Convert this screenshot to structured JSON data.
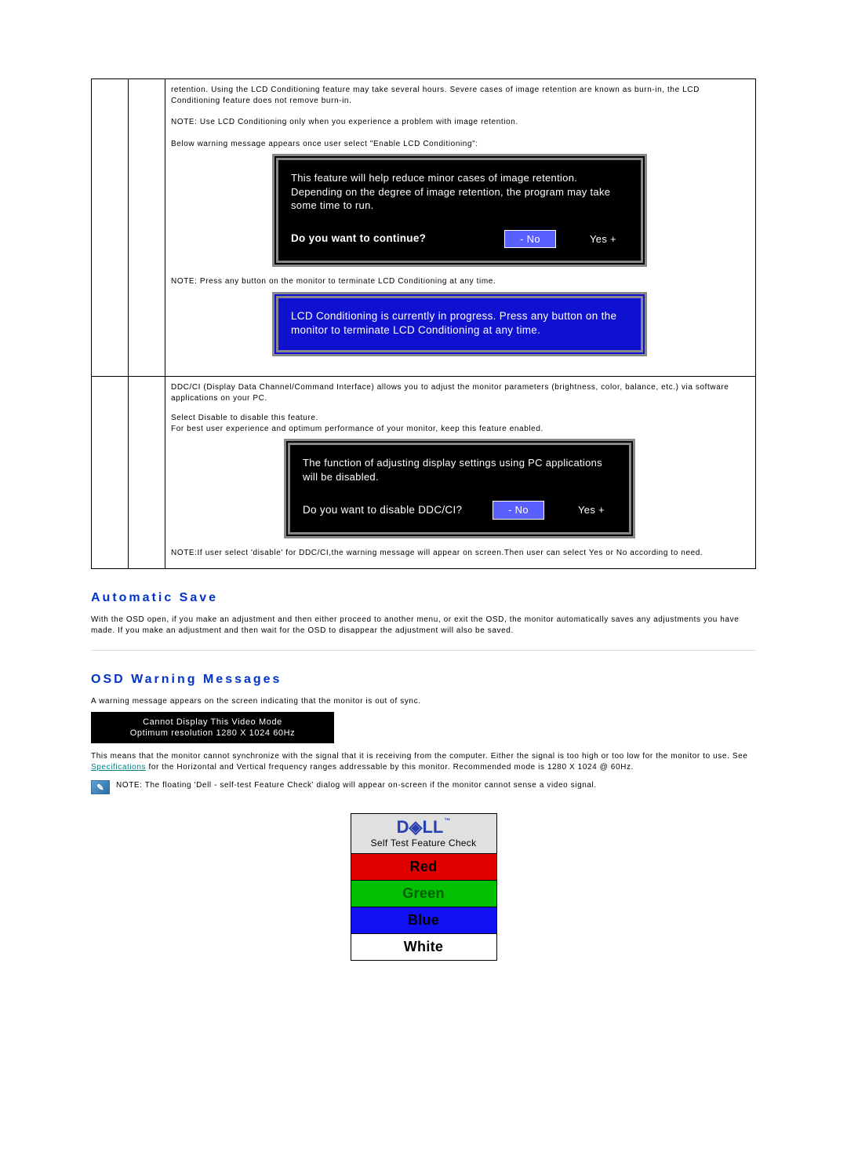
{
  "top_table": {
    "lcd_retention": "retention. Using the LCD Conditioning feature may take several hours. Severe cases of image retention are known as burn-in, the LCD Conditioning feature does not remove burn-in.",
    "lcd_note": "NOTE: Use LCD Conditioning only when you experience a problem with image retention.",
    "lcd_below": "Below warning message appears once user select \"Enable LCD Conditioning\":",
    "lcd_press_note": "NOTE: Press any button on the monitor to terminate LCD Conditioning at any time.",
    "ddcci_intro": "DDC/CI (Display Data Channel/Command Interface) allows you to adjust the monitor parameters (brightness, color, balance, etc.)  via software applications on your PC.",
    "ddcci_disable": "Select Disable to disable this feature.",
    "ddcci_best": "For best user experience and optimum performance of your monitor, keep this feature enabled.",
    "ddcci_note": "NOTE:If user select 'disable' for DDC/CI,the warning message will appear on screen.Then user can select Yes or No according to need."
  },
  "osd_lcd": {
    "body": "This feature will help reduce minor cases of image retention. Depending on the degree of image retention, the program may take some time to run.",
    "question": "Do you want to continue?",
    "no": "- No",
    "yes": "Yes +"
  },
  "osd_progress": {
    "body": "LCD Conditioning is currently in progress.  Press any button on the monitor to terminate LCD Conditioning at any time."
  },
  "osd_ddcci": {
    "body": "The function of adjusting display settings using PC applications will be disabled.",
    "question": "Do you want to disable DDC/CI?",
    "no": "- No",
    "yes": "Yes +"
  },
  "automatic_save": {
    "heading": "Automatic Save",
    "body": "With the OSD open, if you make an adjustment and then either proceed to another menu, or exit the OSD, the monitor automatically saves any adjustments you have made. If you make an adjustment and then wait for the OSD to disappear the adjustment will also be saved."
  },
  "osd_warnings": {
    "heading": "OSD Warning Messages",
    "intro": "A warning message appears on the screen indicating that the monitor is out of sync.",
    "video_mode_line1": "Cannot Display This Video Mode",
    "video_mode_line2": "Optimum resolution 1280 X 1024 60Hz",
    "means_pre": "This means that the monitor cannot synchronize with the signal that it is receiving from the computer. Either the signal is too high or too low for the monitor to use.  See ",
    "spec_link": "Specifications",
    "means_post": " for the Horizontal and Vertical frequency ranges addressable by this monitor. Recommended mode is 1280 X 1024 @ 60Hz.",
    "note_label": "NOTE:",
    "note_body": " The floating 'Dell - self-test Feature Check' dialog will appear on-screen if the monitor cannot sense a video signal."
  },
  "selftest": {
    "brand": "D◈LL",
    "tm": "™",
    "sub": "Self Test Feature Check",
    "bands": {
      "red": "Red",
      "green": "Green",
      "blue": "Blue",
      "white": "White"
    }
  }
}
